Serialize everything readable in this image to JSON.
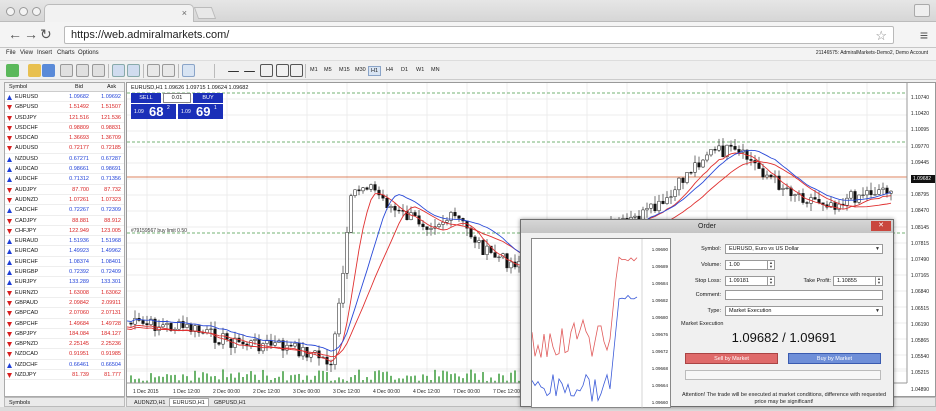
{
  "browser": {
    "url": "https://web.admiralmarkets.com/"
  },
  "menu": {
    "items": [
      "File",
      "View",
      "Insert",
      "Charts",
      "Options"
    ],
    "account": "21146575: AdmiralMarkets-Demo2, Demo Account"
  },
  "toolbar": {
    "timeframes": [
      "M1",
      "M5",
      "M15",
      "M30",
      "H1",
      "H4",
      "D1",
      "W1",
      "MN"
    ],
    "active_timeframe": "H1"
  },
  "market_watch": {
    "headers": {
      "symbol": "Symbol",
      "bid": "Bid",
      "ask": "Ask"
    },
    "rows": [
      {
        "symbol": "EURUSD",
        "bid": "1.09682",
        "ask": "1.09692",
        "dir": "up"
      },
      {
        "symbol": "GBPUSD",
        "bid": "1.51492",
        "ask": "1.51507",
        "dir": "dn"
      },
      {
        "symbol": "USDJPY",
        "bid": "121.516",
        "ask": "121.536",
        "dir": "dn"
      },
      {
        "symbol": "USDCHF",
        "bid": "0.98809",
        "ask": "0.98831",
        "dir": "dn"
      },
      {
        "symbol": "USDCAD",
        "bid": "1.36693",
        "ask": "1.36709",
        "dir": "dn"
      },
      {
        "symbol": "AUDUSD",
        "bid": "0.72177",
        "ask": "0.72185",
        "dir": "dn"
      },
      {
        "symbol": "NZDUSD",
        "bid": "0.67271",
        "ask": "0.67287",
        "dir": "up"
      },
      {
        "symbol": "AUDCAD",
        "bid": "0.98661",
        "ask": "0.98691",
        "dir": "up"
      },
      {
        "symbol": "AUDCHF",
        "bid": "0.71312",
        "ask": "0.71356",
        "dir": "up"
      },
      {
        "symbol": "AUDJPY",
        "bid": "87.700",
        "ask": "87.732",
        "dir": "dn"
      },
      {
        "symbol": "AUDNZD",
        "bid": "1.07261",
        "ask": "1.07323",
        "dir": "dn"
      },
      {
        "symbol": "CADCHF",
        "bid": "0.72267",
        "ask": "0.72309",
        "dir": "up"
      },
      {
        "symbol": "CADJPY",
        "bid": "88.881",
        "ask": "88.912",
        "dir": "dn"
      },
      {
        "symbol": "CHFJPY",
        "bid": "122.949",
        "ask": "123.005",
        "dir": "dn"
      },
      {
        "symbol": "EURAUD",
        "bid": "1.51936",
        "ask": "1.51968",
        "dir": "up"
      },
      {
        "symbol": "EURCAD",
        "bid": "1.49923",
        "ask": "1.49962",
        "dir": "up"
      },
      {
        "symbol": "EURCHF",
        "bid": "1.08374",
        "ask": "1.08401",
        "dir": "up"
      },
      {
        "symbol": "EURGBP",
        "bid": "0.72392",
        "ask": "0.72409",
        "dir": "up"
      },
      {
        "symbol": "EURJPY",
        "bid": "133.289",
        "ask": "133.301",
        "dir": "up"
      },
      {
        "symbol": "EURNZD",
        "bid": "1.63008",
        "ask": "1.63062",
        "dir": "dn"
      },
      {
        "symbol": "GBPAUD",
        "bid": "2.09842",
        "ask": "2.09911",
        "dir": "dn"
      },
      {
        "symbol": "GBPCAD",
        "bid": "2.07060",
        "ask": "2.07131",
        "dir": "dn"
      },
      {
        "symbol": "GBPCHF",
        "bid": "1.49684",
        "ask": "1.49728",
        "dir": "dn"
      },
      {
        "symbol": "GBPJPY",
        "bid": "184.084",
        "ask": "184.127",
        "dir": "dn"
      },
      {
        "symbol": "GBPNZD",
        "bid": "2.25145",
        "ask": "2.25236",
        "dir": "dn"
      },
      {
        "symbol": "NZDCAD",
        "bid": "0.91951",
        "ask": "0.91985",
        "dir": "dn"
      },
      {
        "symbol": "NZDCHF",
        "bid": "0.66461",
        "ask": "0.66504",
        "dir": "up"
      },
      {
        "symbol": "NZDJPY",
        "bid": "81.739",
        "ask": "81.777",
        "dir": "dn"
      }
    ],
    "tab": "Symbols"
  },
  "chart": {
    "title": "EURUSD,H1 1.09626 1.09715 1.09624 1.09682",
    "sell_label": "SELL",
    "buy_label": "BUY",
    "volume": "0.01",
    "sell_small": "1.09",
    "sell_big": "68",
    "sell_sup": "2",
    "buy_small": "1.09",
    "buy_big": "69",
    "buy_sup": "1",
    "hline_label": "#79159567 buy limit 0.50",
    "current_price": "1.09682",
    "price_ticks": [
      "1.10740",
      "1.10420",
      "1.10095",
      "1.09770",
      "1.09445",
      "1.09120",
      "1.08795",
      "1.08470",
      "1.08145",
      "1.07815",
      "1.07490",
      "1.07165",
      "1.06840",
      "1.06515",
      "1.06190",
      "1.05865",
      "1.05540",
      "1.05215",
      "1.04890"
    ],
    "time_ticks": [
      "1 Dec 2015",
      "1 Dec 12:00",
      "2 Dec 00:00",
      "2 Dec 12:00",
      "3 Dec 00:00",
      "3 Dec 12:00",
      "4 Dec 00:00",
      "4 Dec 12:00",
      "7 Dec 00:00",
      "7 Dec 12:00"
    ],
    "tabs": [
      "AUDNZD,H1",
      "EURUSD,H1",
      "GBPUSD,H1"
    ],
    "active_tab": "EURUSD,H1"
  },
  "order": {
    "title": "Order",
    "symbol_label": "Symbol:",
    "symbol_value": "EURUSD, Euro vs US Dollar",
    "volume_label": "Volume:",
    "volume_value": "1.00",
    "stop_loss_label": "Stop Loss:",
    "stop_loss_value": "1.09181",
    "take_profit_label": "Take Profit:",
    "take_profit_value": "1.10855",
    "comment_label": "Comment:",
    "comment_value": "",
    "type_label": "Type:",
    "type_value": "Market Execution",
    "market_execution_label": "Market Execution",
    "prices": "1.09682 / 1.09691",
    "sell_button": "Sell by Market",
    "buy_button": "Buy by Market",
    "attention": "Attention! The trade will be executed at market conditions, difference with requested price may be significant!",
    "mini_ticks": [
      "1.09690",
      "1.09689",
      "1.09684",
      "1.09682",
      "1.09680",
      "1.09676",
      "1.09672",
      "1.09668",
      "1.09664",
      "1.09660"
    ]
  },
  "colors": {
    "up": "#1e3fd8",
    "down": "#d81e1e",
    "sell_blue": "#1a2fb8",
    "ma_red": "#e03030",
    "ma_blue": "#2a4ad8"
  }
}
